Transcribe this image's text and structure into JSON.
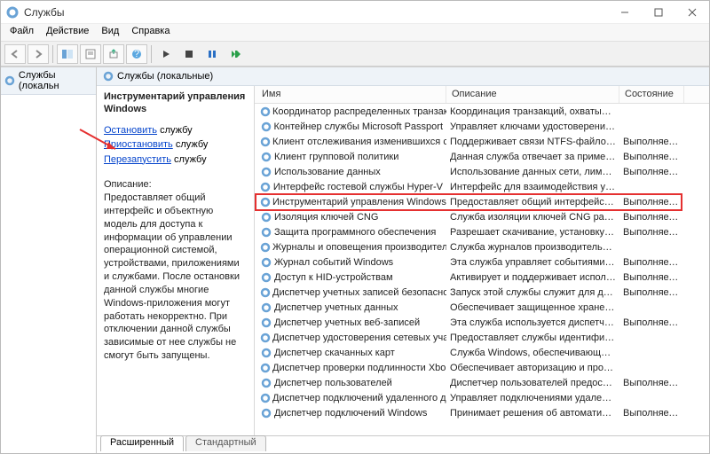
{
  "window": {
    "title": "Службы"
  },
  "menu": {
    "file": "Файл",
    "action": "Действие",
    "view": "Вид",
    "help": "Справка"
  },
  "tree": {
    "root": "Службы (локальн"
  },
  "main_header": "Службы (локальные)",
  "detail": {
    "title": "Инструментарий управления Windows",
    "stop": "Остановить",
    "stop_sfx": " службу",
    "pause": "Приостановить",
    "pause_sfx": " службу",
    "restart": "Перезапустить",
    "restart_sfx": " службу",
    "desc_label": "Описание:",
    "desc": "Предоставляет общий интерфейс и объектную модель для доступа к информации об управлении операционной системой, устройствами, приложениями и службами. После остановки данной службы многие Windows-приложения могут работать некорректно. При отключении данной службы зависимые от нее службы не смогут быть запущены."
  },
  "columns": {
    "name": "Имя",
    "description": "Описание",
    "state": "Состояние"
  },
  "rows": [
    {
      "name": "Координатор распределенных транзак",
      "desc": "Координация транзакций, охватывающ…",
      "state": ""
    },
    {
      "name": "Контейнер службы Microsoft Passport",
      "desc": "Управляет ключами удостоверений лок…",
      "state": ""
    },
    {
      "name": "Клиент отслеживания изменившихся св…",
      "desc": "Поддерживает связи NTFS-файлов, пер…",
      "state": "Выполняется"
    },
    {
      "name": "Клиент групповой политики",
      "desc": "Данная служба отвечает за применени…",
      "state": "Выполняется"
    },
    {
      "name": "Использование данных",
      "desc": "Использование данных сети, лимит тра…",
      "state": "Выполняется"
    },
    {
      "name": "Интерфейс гостевой службы Hyper-V",
      "desc": "Интерфейс для взаимодействия узла Hy…",
      "state": ""
    },
    {
      "name": "Инструментарий управления Windows",
      "desc": "Предоставляет общий интерфейс и об…",
      "state": "Выполняется"
    },
    {
      "name": "Изоляция ключей CNG",
      "desc": "Служба изоляции ключей CNG размещ…",
      "state": "Выполняется"
    },
    {
      "name": "Защита программного обеспечения",
      "desc": "Разрешает скачивание, установку и при…",
      "state": "Выполняется"
    },
    {
      "name": "Журналы и оповещения производитель…",
      "desc": "Служба журналов производительности…",
      "state": ""
    },
    {
      "name": "Журнал событий Windows",
      "desc": "Эта служба управляет событиями и жу…",
      "state": "Выполняется"
    },
    {
      "name": "Доступ к HID-устройствам",
      "desc": "Активирует и поддерживает использова…",
      "state": "Выполняется"
    },
    {
      "name": "Диспетчер учетных записей безопасно",
      "desc": "Запуск этой службы служит для других с…",
      "state": "Выполняется"
    },
    {
      "name": "Диспетчер учетных данных",
      "desc": "Обеспечивает защищенное хранение и …",
      "state": ""
    },
    {
      "name": "Диспетчер учетных веб-записей",
      "desc": "Эта служба используется диспетчером …",
      "state": "Выполняется"
    },
    {
      "name": "Диспетчер удостоверения сетевых учас",
      "desc": "Предоставляет службы идентификации …",
      "state": ""
    },
    {
      "name": "Диспетчер скачанных карт",
      "desc": "Служба Windows, обеспечивающая дост…",
      "state": ""
    },
    {
      "name": "Диспетчер проверки подлинности Xbo…",
      "desc": "Обеспечивает авторизацию и проверк…",
      "state": ""
    },
    {
      "name": "Диспетчер пользователей",
      "desc": "Диспетчер пользователей предоставля…",
      "state": "Выполняется"
    },
    {
      "name": "Диспетчер подключений удаленного д…",
      "desc": "Управляет подключениями удаленного …",
      "state": ""
    },
    {
      "name": "Диспетчер подключений Windows",
      "desc": "Принимает решения об автоматическо…",
      "state": "Выполняется"
    }
  ],
  "tabs": {
    "ext": "Расширенный",
    "std": "Стандартный"
  }
}
